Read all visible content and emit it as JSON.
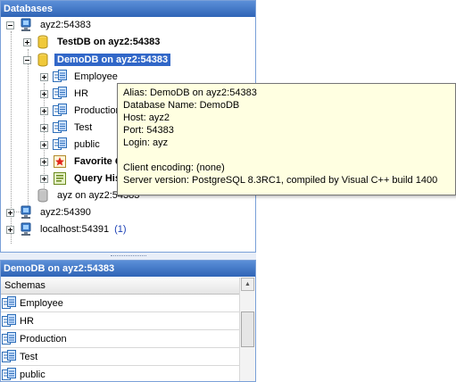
{
  "top_panel": {
    "title": "Databases"
  },
  "tree": {
    "server1": "ayz2:54383",
    "db1": "TestDB on ayz2:54383",
    "db2": "DemoDB on ayz2:54383",
    "schemas": [
      "Employee",
      "HR",
      "Production",
      "Test",
      "public"
    ],
    "favorites": "Favorite Queries",
    "query_history": "Query History",
    "db3": "ayz on ayz2:54383",
    "server2": "ayz2:54390",
    "server3": "localhost:54391",
    "server3_count": "(1)"
  },
  "tooltip": {
    "alias": "Alias: DemoDB on ayz2:54383",
    "database_name": "Database Name: DemoDB",
    "host": "Host: ayz2",
    "port": "Port: 54383",
    "login": "Login: ayz",
    "client_encoding": "Client encoding: (none)",
    "server_version": "Server version: PostgreSQL 8.3RC1, compiled by Visual C++ build 1400"
  },
  "bottom_panel": {
    "title": "DemoDB on ayz2:54383",
    "column_header": "Schemas",
    "rows": [
      "Employee",
      "HR",
      "Production",
      "Test",
      "public"
    ]
  }
}
